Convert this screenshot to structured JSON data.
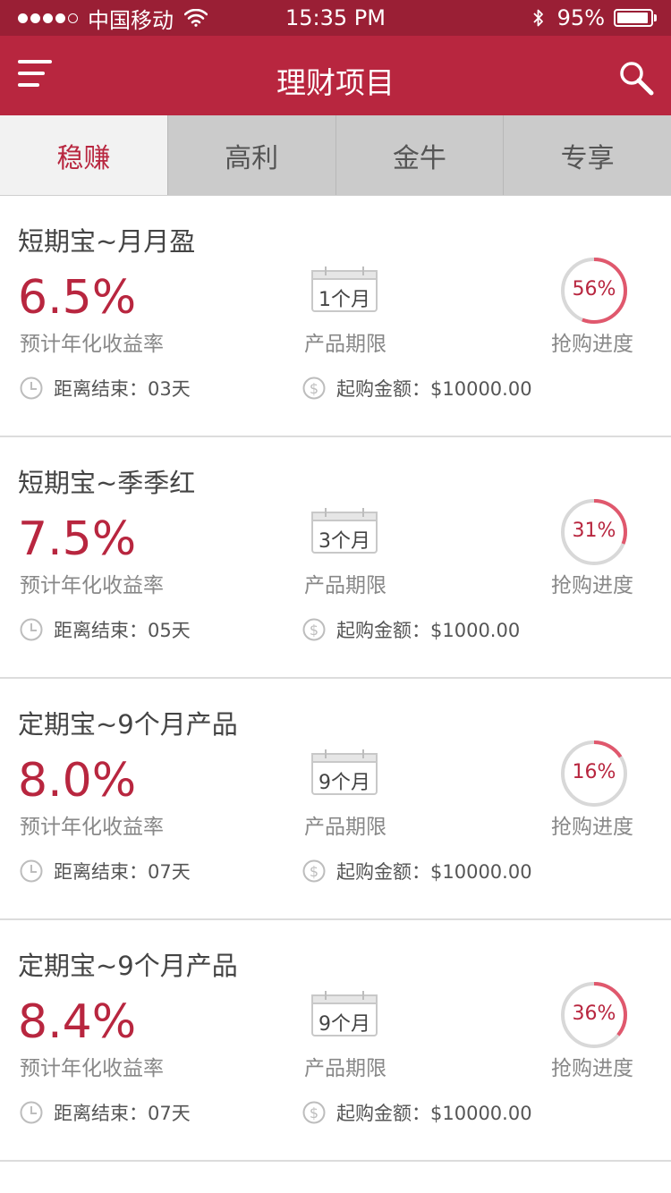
{
  "status_bar": {
    "carrier": "中国移动",
    "time": "15:35 PM",
    "battery_pct": "95%",
    "battery_level": 0.95,
    "signal_bars_filled": 4,
    "signal_bars_total": 5
  },
  "nav": {
    "title": "理财项目",
    "menu_icon": "hamburger-menu-icon",
    "search_icon": "search-icon"
  },
  "tabs": [
    {
      "label": "稳赚",
      "active": true
    },
    {
      "label": "高利",
      "active": false
    },
    {
      "label": "金牛",
      "active": false
    },
    {
      "label": "专享",
      "active": false
    }
  ],
  "colors": {
    "status_bar": "#9a1f35",
    "nav_bar": "#b8263f",
    "accent": "#b8263f",
    "ring_progress": "#e0586d",
    "ring_track": "#d8d8d8",
    "tab_inactive": "#cbcbcb",
    "tab_active": "#f2f2f2"
  },
  "products": [
    {
      "name": "短期宝~月月盈",
      "rate": "6.5%",
      "rate_label": "预计年化收益率",
      "term": "1个月",
      "term_label": "产品期限",
      "progress_text": "56%",
      "progress": 0.56,
      "progress_label": "抢购进度",
      "end_text": "距离结束：03天",
      "amount_text": "起购金额：$10000.00"
    },
    {
      "name": "短期宝~季季红",
      "rate": "7.5%",
      "rate_label": "预计年化收益率",
      "term": "3个月",
      "term_label": "产品期限",
      "progress_text": "31%",
      "progress": 0.31,
      "progress_label": "抢购进度",
      "end_text": "距离结束：05天",
      "amount_text": "起购金额：$1000.00"
    },
    {
      "name": "定期宝~9个月产品",
      "rate": "8.0%",
      "rate_label": "预计年化收益率",
      "term": "9个月",
      "term_label": "产品期限",
      "progress_text": "16%",
      "progress": 0.16,
      "progress_label": "抢购进度",
      "end_text": "距离结束：07天",
      "amount_text": "起购金额：$10000.00"
    },
    {
      "name": "定期宝~9个月产品",
      "rate": "8.4%",
      "rate_label": "预计年化收益率",
      "term": "9个月",
      "term_label": "产品期限",
      "progress_text": "36%",
      "progress": 0.36,
      "progress_label": "抢购进度",
      "end_text": "距离结束：07天",
      "amount_text": "起购金额：$10000.00"
    }
  ]
}
